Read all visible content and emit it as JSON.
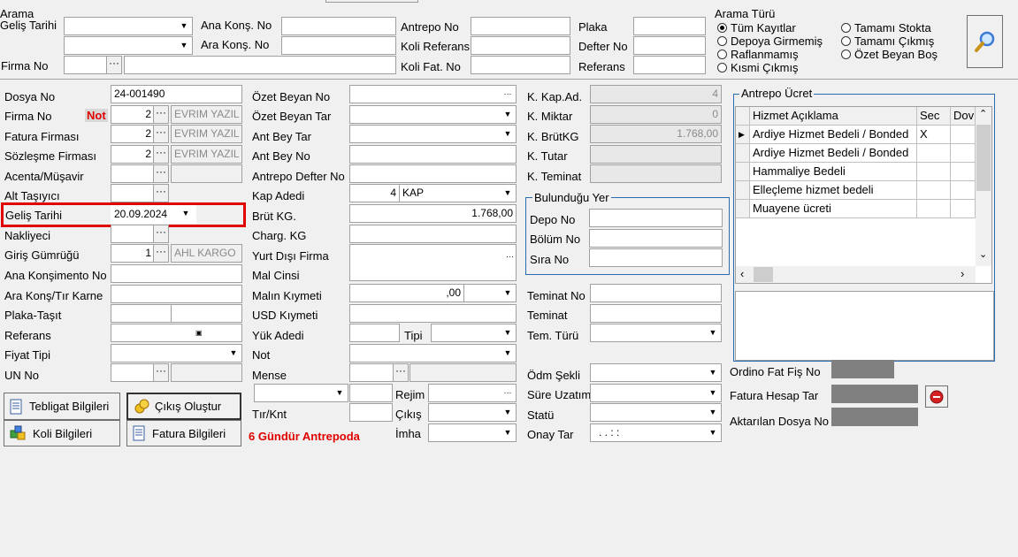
{
  "top": {
    "arama_label": "Arama",
    "gelis_tarihi_label": "Geliş Tarihi",
    "firma_no_label": "Firma No",
    "ana_kons_no_label": "Ana Konş. No",
    "ara_kons_no_label": "Ara Konş. No",
    "antrepo_no_label": "Antrepo No",
    "koli_referans_label": "Koli Referans",
    "koli_fat_no_label": "Koli Fat. No",
    "plaka_label": "Plaka",
    "defter_no_label": "Defter No",
    "referans_label": "Referans",
    "arama_turu_label": "Arama Türü",
    "radios": [
      {
        "label": "Tüm Kayıtlar",
        "checked": true
      },
      {
        "label": "Depoya Girmemiş",
        "checked": false
      },
      {
        "label": "Raflanmamış",
        "checked": false
      },
      {
        "label": "Kısmi Çıkmış",
        "checked": false
      },
      {
        "label": "Tamamı Stokta",
        "checked": false
      },
      {
        "label": "Tamamı Çıkmış",
        "checked": false
      },
      {
        "label": "Özet Beyan Boş",
        "checked": false
      }
    ],
    "search_icon": "magnifier-icon"
  },
  "left": {
    "dosya_no_label": "Dosya No",
    "dosya_no_value": "24-001490",
    "firma_no_label": "Firma No",
    "not_label": "Not",
    "firma_no_value": "2",
    "firma_name": "EVRIM YAZIL",
    "fatura_firmasi_label": "Fatura Firması",
    "fatura_firmasi_value": "2",
    "fatura_firmasi_name": "EVRIM YAZIL",
    "sozlesme_label": "Sözleşme Firması",
    "sozlesme_value": "2",
    "sozlesme_name": "EVRIM YAZIL",
    "acenta_label": "Acenta/Müşavir",
    "alt_tasiyici_label": "Alt Taşıyıcı",
    "gelis_tarihi_label": "Geliş Tarihi",
    "gelis_tarihi_value": "20.09.2024",
    "nakliyeci_label": "Nakliyeci",
    "giris_gumrugu_label": "Giriş Gümrüğü",
    "giris_gumrugu_value": "1",
    "giris_gumrugu_name": "AHL KARGO",
    "ana_konsimento_label": "Ana Konşimento No",
    "ara_kons_label": "Ara Konş/Tır Karne",
    "plaka_label": "Plaka-Taşıt",
    "referans_label": "Referans",
    "fiyat_tipi_label": "Fiyat Tipi",
    "un_no_label": "UN No"
  },
  "buttons": {
    "tebligat": "Tebligat Bilgileri",
    "cikis_olustur": "Çıkış Oluştur",
    "koli": "Koli Bilgileri",
    "fatura": "Fatura Bilgileri"
  },
  "gun_text": "6 Gündür Antrepoda",
  "middle": {
    "ozet_beyan_no": "Özet Beyan No",
    "ozet_beyan_tar": "Özet Beyan Tar",
    "ant_bey_tar": "Ant Bey Tar",
    "ant_bey_no": "Ant Bey No",
    "antrepo_defter_no": "Antrepo Defter No",
    "kap_adedi": "Kap Adedi",
    "kap_adedi_value": "4",
    "kap_unit": "KAP",
    "brut_kg": "Brüt KG.",
    "brut_kg_value": "1.768,00",
    "charg_kg": "Charg. KG",
    "yurt_disi": "Yurt Dışı Firma",
    "mal_cinsi": "Mal Cinsi",
    "malin_kiymeti": "Malın Kıymeti",
    "malin_kiymeti_value": ",00",
    "usd_kiymeti": "USD Kıymeti",
    "yuk_adedi": "Yük Adedi",
    "tipi": "Tipi",
    "not": "Not",
    "mense": "Mense",
    "rejim": "Rejim",
    "tir_knt": "Tır/Knt",
    "cikis": "Çıkış",
    "imha": "İmha"
  },
  "right": {
    "k_kap_ad": "K. Kap.Ad.",
    "k_kap_ad_value": "4",
    "k_miktar": "K. Miktar",
    "k_miktar_value": "0",
    "k_brutkg": "K. BrütKG",
    "k_brutkg_value": "1.768,00",
    "k_tutar": "K. Tutar",
    "k_teminat": "K. Teminat",
    "bulundugu_yer": "Bulunduğu Yer",
    "depo_no": "Depo No",
    "bolum_no": "Bölüm No",
    "sira_no": "Sıra No",
    "teminat_no": "Teminat No",
    "teminat": "Teminat",
    "tem_turu": "Tem. Türü",
    "odm_sekli": "Ödm Şekli",
    "sure_uzatim": "Süre Uzatım",
    "statu": "Statü",
    "onay_tar": "Onay Tar",
    "onay_tar_value": ". .    : :"
  },
  "antrepo_ucret": {
    "title": "Antrepo Ücret",
    "columns": [
      "Hizmet Açıklama",
      "Sec",
      "Dov"
    ],
    "rows": [
      {
        "aciklama": "Ardiye Hizmet Bedeli / Bonded",
        "sec": "X"
      },
      {
        "aciklama": "Ardiye Hizmet Bedeli / Bonded",
        "sec": ""
      },
      {
        "aciklama": "Hammaliye Bedeli",
        "sec": ""
      },
      {
        "aciklama": "Elleçleme hizmet bedeli",
        "sec": ""
      },
      {
        "aciklama": "Muayene ücreti",
        "sec": ""
      }
    ]
  },
  "bottom_right": {
    "ordino": "Ordino Fat Fiş No",
    "fatura_hesap_tar": "Fatura Hesap Tar",
    "aktarilan_dosya": "Aktarılan Dosya No"
  },
  "colors": {
    "accent_red": "#e00000",
    "highlight_box": "#e00000",
    "panel_border": "#2b6cb0"
  }
}
